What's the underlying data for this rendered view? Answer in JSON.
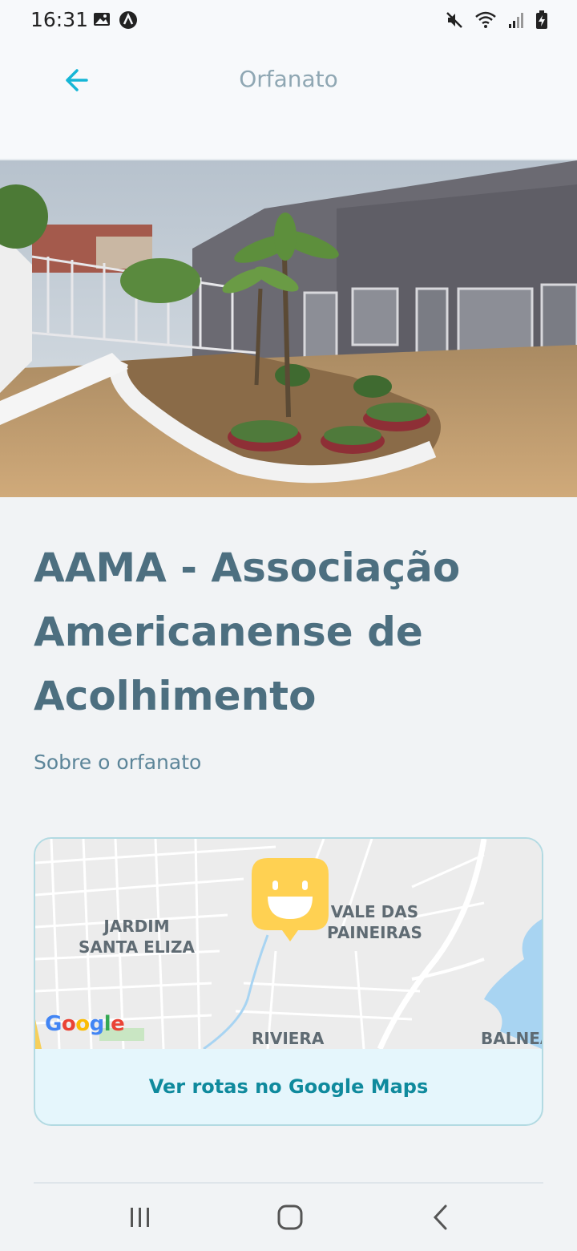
{
  "status_bar": {
    "time": "16:31",
    "left_icons": [
      "gallery-icon",
      "app-notification-icon"
    ],
    "right_icons": [
      "mute-icon",
      "wifi-icon",
      "signal-icon",
      "battery-charging-icon"
    ]
  },
  "header": {
    "title": "Orfanato",
    "back_icon": "arrow-left-icon",
    "accent_color": "#15b6d6"
  },
  "orphanage": {
    "name": "AAMA - Associação Americanense de Acolhimento",
    "about_label": "Sobre o orfanato"
  },
  "map": {
    "labels": {
      "jardim": "JARDIM\nSANTA ELIZA",
      "vale": "VALE DAS\nPAINEIRAS",
      "riviera": "RIVIERA",
      "balnea": "BALNEA"
    },
    "logo": "Google",
    "pin_color": "#ffd152",
    "button_label": "Ver rotas no Google Maps"
  },
  "nav_bar": {
    "icons": [
      "recents-icon",
      "home-icon",
      "back-icon"
    ]
  }
}
